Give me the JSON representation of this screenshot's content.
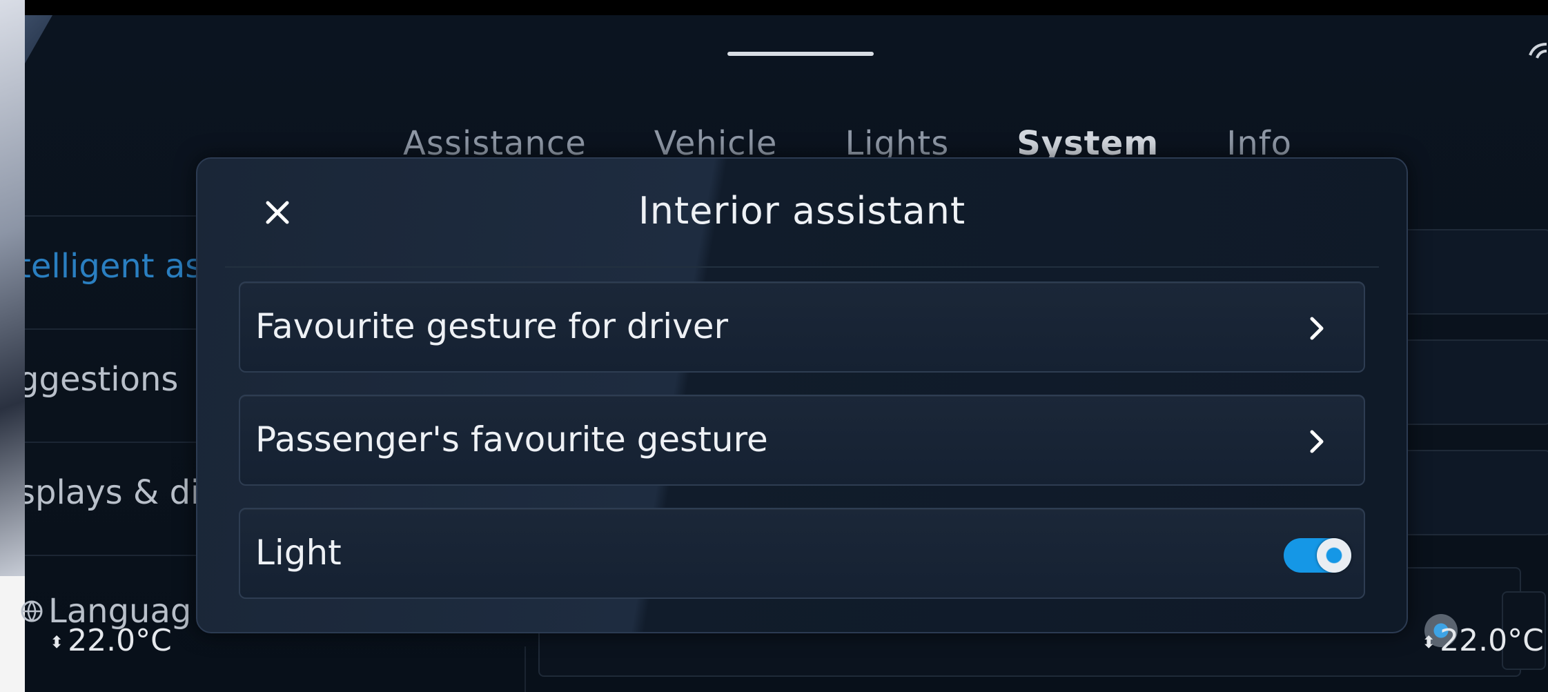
{
  "tabs": [
    {
      "label": "Assistance",
      "active": false
    },
    {
      "label": "Vehicle",
      "active": false
    },
    {
      "label": "Lights",
      "active": false
    },
    {
      "label": "System",
      "active": true
    },
    {
      "label": "Info",
      "active": false
    }
  ],
  "background_list": [
    {
      "label": "telligent as",
      "highlight": true
    },
    {
      "label": "ggestions",
      "highlight": false
    },
    {
      "label": "splays & dis",
      "highlight": false
    }
  ],
  "language_label": "Languag",
  "climate": {
    "left_temp": "22.0°C",
    "right_temp": "22.0°C"
  },
  "dialog": {
    "title": "Interior assistant",
    "rows": [
      {
        "label": "Favourite gesture for driver",
        "control": "chevron"
      },
      {
        "label": "Passenger's favourite gesture",
        "control": "chevron"
      },
      {
        "label": "Light",
        "control": "toggle",
        "toggle_on": true
      }
    ]
  },
  "colors": {
    "accent": "#1597e6",
    "highlight_text": "#2a7fc1"
  },
  "icons": {
    "close": "close-icon",
    "chevron": "chevron-right-icon",
    "globe": "globe-icon",
    "wifi": "wifi-icon"
  }
}
